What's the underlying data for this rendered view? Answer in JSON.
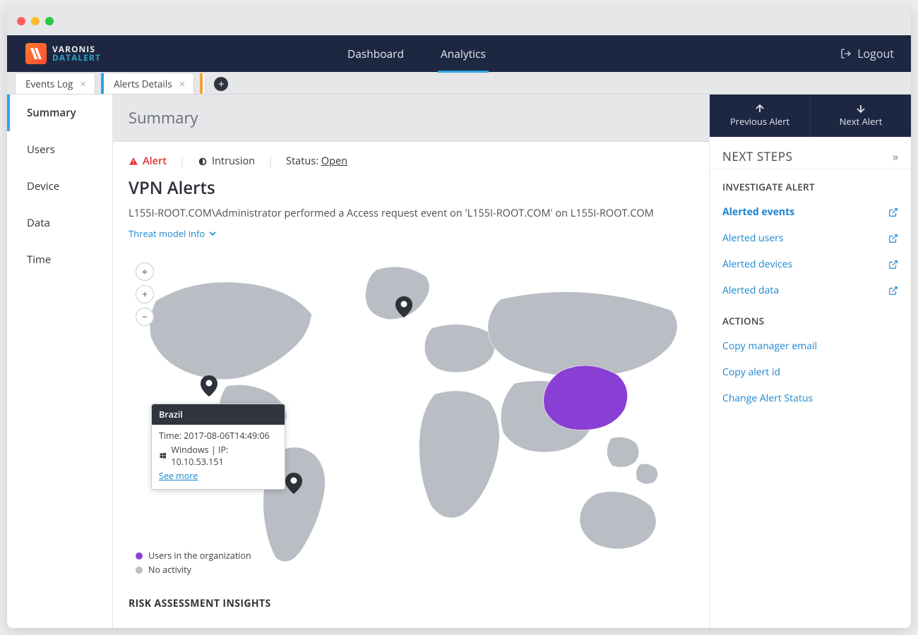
{
  "brand": {
    "top": "VARONIS",
    "bot": "DATALERT"
  },
  "nav": {
    "dashboard": "Dashboard",
    "analytics": "Analytics",
    "logout": "Logout"
  },
  "tabs": {
    "events_log": "Events  Log",
    "alerts_details": "Alerts Details"
  },
  "side": [
    "Summary",
    "Users",
    "Device",
    "Data",
    "Time"
  ],
  "page_title": "Summary",
  "meta": {
    "alert": "Alert",
    "intrusion": "Intrusion",
    "status_label": "Status:",
    "status_value": "Open"
  },
  "heading": "VPN Alerts",
  "description": "L155I-ROOT.COM\\Administrator performed a Access request event on 'L155I-ROOT.COM' on L155I-ROOT.COM",
  "threat_model_info": "Threat model info",
  "tooltip": {
    "country": "Brazil",
    "time": "Time: 2017-08-06T14:49:06",
    "os_ip": "Windows | IP: 10.10.53.151",
    "see_more": "See more"
  },
  "legend": {
    "users": "Users in the organization",
    "noact": "No activity"
  },
  "risk_heading": "RISK ASSESSMENT INSIGHTS",
  "alert_nav": {
    "prev": "Previous Alert",
    "next": "Next Alert"
  },
  "next_steps": {
    "title": "NEXT STEPS"
  },
  "investigate": {
    "title": "INVESTIGATE ALERT",
    "events": "Alerted events",
    "users": "Alerted users",
    "devices": "Alerted devices",
    "data": "Alerted data"
  },
  "actions": {
    "title": "ACTIONS",
    "copy_mgr": "Copy manager email",
    "copy_id": "Copy alert id",
    "change_status": "Change Alert Status"
  },
  "colors": {
    "purple": "#8a3fd4",
    "gray": "#b9bdc4"
  }
}
